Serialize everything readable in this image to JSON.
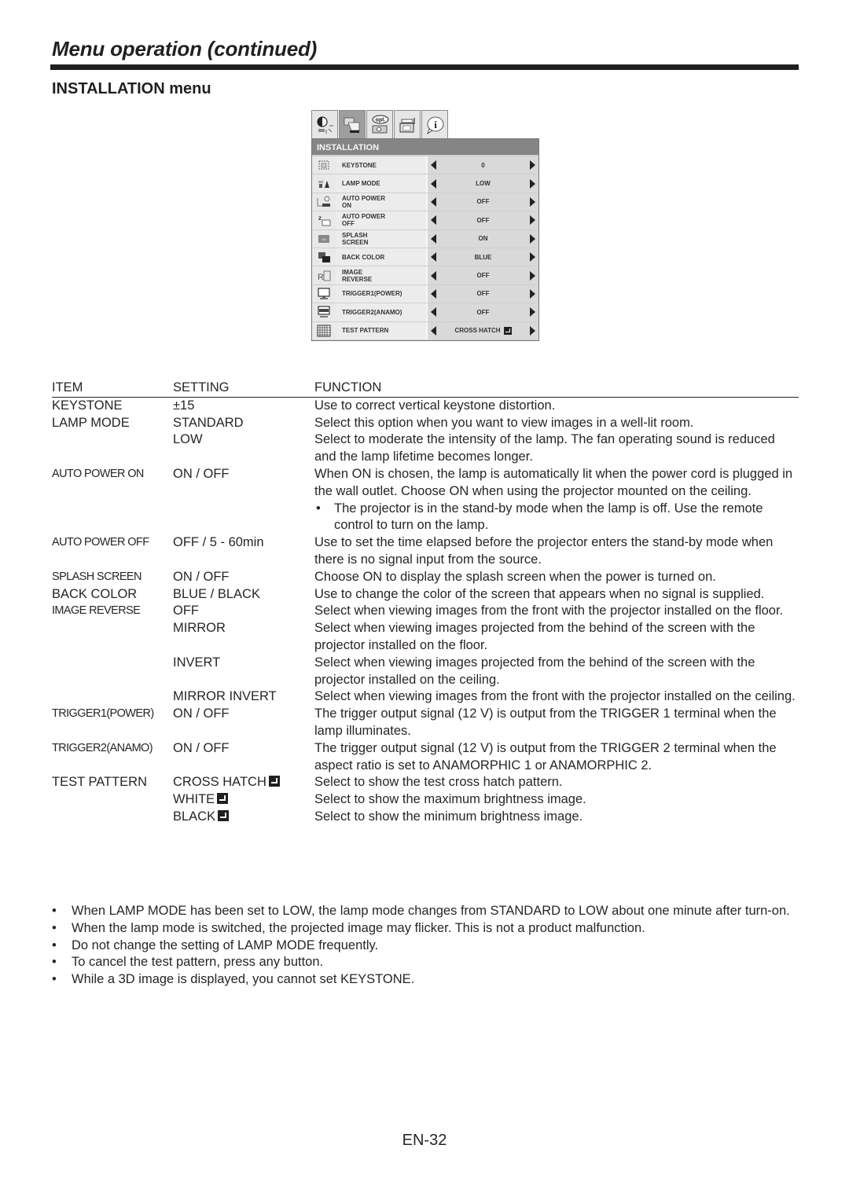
{
  "header": {
    "title": "Menu operation (continued)",
    "section": "INSTALLATION menu"
  },
  "osd": {
    "tabs": [
      {
        "icon": "picture-adjust-icon",
        "active": false
      },
      {
        "icon": "installation-icon",
        "active": true
      },
      {
        "icon": "option-icon",
        "label": "opt.",
        "active": false
      },
      {
        "icon": "signal-icon",
        "active": false
      },
      {
        "icon": "info-icon",
        "label": "i",
        "active": false
      }
    ],
    "header": "INSTALLATION",
    "rows": [
      {
        "icon": "keystone-icon",
        "label": "KEYSTONE",
        "value": "0"
      },
      {
        "icon": "lamp-mode-icon",
        "label": "LAMP MODE",
        "value": "LOW"
      },
      {
        "icon": "auto-power-on-icon",
        "label": "AUTO POWER ON",
        "value": "OFF"
      },
      {
        "icon": "auto-power-off-icon",
        "label": "AUTO POWER OFF",
        "value": "OFF"
      },
      {
        "icon": "splash-screen-icon",
        "label": "SPLASH SCREEN",
        "value": "ON"
      },
      {
        "icon": "back-color-icon",
        "label": "BACK COLOR",
        "value": "BLUE"
      },
      {
        "icon": "image-reverse-icon",
        "label": "IMAGE REVERSE",
        "value": "OFF"
      },
      {
        "icon": "trigger1-icon",
        "label": "TRIGGER1(POWER)",
        "value": "OFF"
      },
      {
        "icon": "trigger2-icon",
        "label": "TRIGGER2(ANAMO)",
        "value": "OFF"
      },
      {
        "icon": "test-pattern-icon",
        "label": "TEST PATTERN",
        "value": "CROSS HATCH",
        "enter": true
      }
    ]
  },
  "table": {
    "headers": {
      "item": "ITEM",
      "setting": "SETTING",
      "function": "FUNCTION"
    },
    "rows": [
      {
        "item": "KEYSTONE",
        "setting": "±15",
        "function": "Use to correct vertical keystone distortion."
      },
      {
        "item": "LAMP MODE",
        "setting": "STANDARD",
        "function": "Select this option when you want to view images in a well-lit room."
      },
      {
        "item": "",
        "setting": "LOW",
        "function": "Select to moderate the intensity of the lamp. The fan operating sound is reduced and the lamp lifetime becomes longer."
      },
      {
        "item": "AUTO POWER ON",
        "setting": "ON / OFF",
        "function": "When ON is chosen, the lamp is automatically lit when the power cord is plugged in the wall outlet. Choose ON when using the projector mounted on the ceiling.",
        "bullet": "The projector is in the stand-by mode when the lamp is off. Use the remote control to turn on the lamp."
      },
      {
        "item": "AUTO POWER OFF",
        "setting": "OFF / 5 - 60min",
        "function": "Use to set the time elapsed before the projector enters the stand-by mode when there is no signal input from the source."
      },
      {
        "item": "SPLASH SCREEN",
        "setting": "ON / OFF",
        "function": "Choose ON to display the splash screen when the power is turned on."
      },
      {
        "item": "BACK COLOR",
        "setting": "BLUE / BLACK",
        "function": "Use to change the color of the screen that appears when no signal is supplied."
      },
      {
        "item": "IMAGE REVERSE",
        "setting": "OFF",
        "function": "Select when viewing images from the front with the projector installed on the floor."
      },
      {
        "item": "",
        "setting": "MIRROR",
        "function": "Select when viewing images projected from the behind of the screen with the projector installed on the floor."
      },
      {
        "item": "",
        "setting": "INVERT",
        "function": "Select when viewing images projected from the behind of the screen with the projector installed on the ceiling."
      },
      {
        "item": "",
        "setting": "MIRROR INVERT",
        "function": "Select when viewing images from the front with the projector installed on the ceiling."
      },
      {
        "item": "TRIGGER1(POWER)",
        "setting": "ON / OFF",
        "function": "The trigger output signal (12 V) is output from the TRIGGER 1 terminal when the lamp illuminates."
      },
      {
        "item": "TRIGGER2(ANAMO)",
        "setting": "ON / OFF",
        "function": "The trigger output signal (12 V) is output from the TRIGGER 2 terminal when the aspect ratio is set to ANAMORPHIC 1 or ANAMORPHIC 2."
      },
      {
        "item": "TEST PATTERN",
        "setting": "CROSS HATCH",
        "function": "Select to show the test cross hatch pattern.",
        "enter": true
      },
      {
        "item": "",
        "setting": "WHITE",
        "function": "Select to show the maximum brightness image.",
        "enter": true
      },
      {
        "item": "",
        "setting": "BLACK",
        "function": "Select to show the minimum brightness image.",
        "enter": true
      }
    ]
  },
  "notes": [
    "When LAMP MODE has been set to LOW, the lamp mode changes from STANDARD to LOW about one minute after turn-on.",
    "When the lamp mode is switched, the projected image may flicker. This is not a product malfunction.",
    "Do not change the setting of LAMP MODE frequently.",
    "To cancel the test pattern, press any button.",
    "While a 3D image is displayed, you cannot set KEYSTONE."
  ],
  "bullet_char": "•",
  "page_number": "EN-32"
}
